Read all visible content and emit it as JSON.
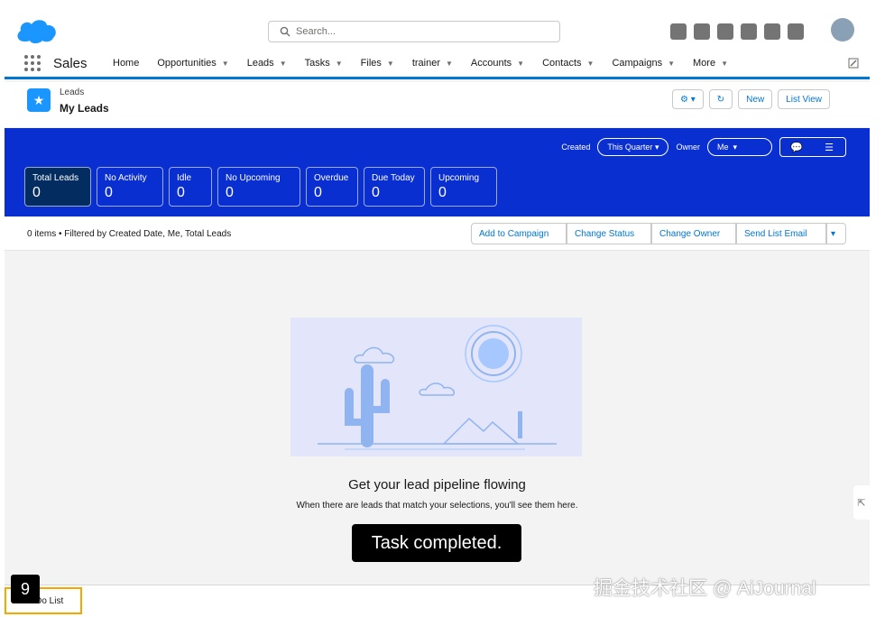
{
  "header": {
    "search_placeholder": "Search..."
  },
  "nav": {
    "app_name": "Sales",
    "items": [
      {
        "label": "Home",
        "caret": false
      },
      {
        "label": "Opportunities",
        "caret": true
      },
      {
        "label": "Leads",
        "caret": true
      },
      {
        "label": "Tasks",
        "caret": true
      },
      {
        "label": "Files",
        "caret": true
      },
      {
        "label": "trainer",
        "caret": true
      },
      {
        "label": "Accounts",
        "caret": true
      },
      {
        "label": "Contacts",
        "caret": true
      },
      {
        "label": "Campaigns",
        "caret": true
      },
      {
        "label": "More",
        "caret": true
      }
    ]
  },
  "list_header": {
    "object_label": "Leads",
    "list_name": "My Leads",
    "new_label": "New",
    "list_view_label": "List View"
  },
  "filters": {
    "created_label": "Created",
    "created_value": "This Quarter",
    "owner_label": "Owner",
    "owner_value": "Me"
  },
  "tiles": [
    {
      "label": "Total Leads",
      "value": "0"
    },
    {
      "label": "No Activity",
      "value": "0"
    },
    {
      "label": "Idle",
      "value": "0"
    },
    {
      "label": "No Upcoming",
      "value": "0"
    },
    {
      "label": "Overdue",
      "value": "0"
    },
    {
      "label": "Due Today",
      "value": "0"
    },
    {
      "label": "Upcoming",
      "value": "0"
    }
  ],
  "itembar": {
    "count_text": "0 items • Filtered by Created Date, Me, Total Leads",
    "actions": [
      "Add to Campaign",
      "Change Status",
      "Change Owner",
      "Send List Email"
    ]
  },
  "empty_state": {
    "title": "Get your lead pipeline flowing",
    "subtitle": "When there are leads that match your selections, you'll see them here."
  },
  "toast": "Task completed.",
  "utility": {
    "todo_label": "To Do List",
    "step_number": "9"
  },
  "watermark": "掘金技术社区 @ AiJournal",
  "colors": {
    "brand_blue": "#0176d3",
    "band_blue": "#0a2fd1",
    "tile_selected": "#032d60"
  }
}
